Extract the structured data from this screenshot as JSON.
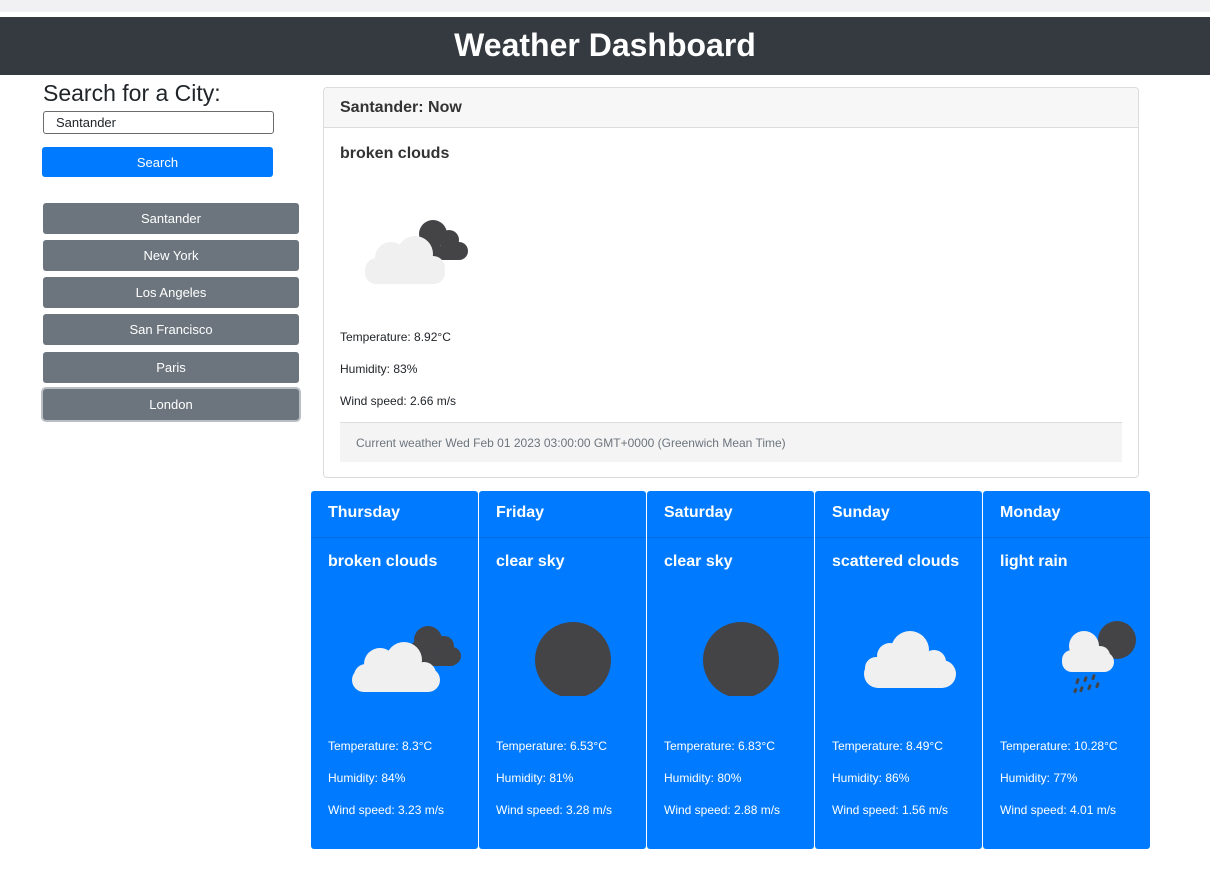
{
  "header": {
    "title": "Weather Dashboard"
  },
  "search": {
    "heading": "Search for a City:",
    "value": "Santander",
    "button_label": "Search"
  },
  "history": {
    "cities": [
      "Santander",
      "New York",
      "Los Angeles",
      "San Francisco",
      "Paris",
      "London"
    ]
  },
  "current": {
    "header": "Santander: Now",
    "description": "broken clouds",
    "icon": "broken-clouds-icon",
    "temperature": "Temperature: 8.92°C",
    "humidity": "Humidity: 83%",
    "wind": "Wind speed: 2.66 m/s",
    "footer": "Current weather Wed Feb 01 2023 03:00:00 GMT+0000 (Greenwich Mean Time)"
  },
  "forecast": [
    {
      "day": "Thursday",
      "description": "broken clouds",
      "icon": "broken-clouds-icon",
      "temperature": "Temperature: 8.3°C",
      "humidity": "Humidity: 84%",
      "wind": "Wind speed: 3.23 m/s"
    },
    {
      "day": "Friday",
      "description": "clear sky",
      "icon": "clear-sky-icon",
      "temperature": "Temperature: 6.53°C",
      "humidity": "Humidity: 81%",
      "wind": "Wind speed: 3.28 m/s"
    },
    {
      "day": "Saturday",
      "description": "clear sky",
      "icon": "clear-sky-icon",
      "temperature": "Temperature: 6.83°C",
      "humidity": "Humidity: 80%",
      "wind": "Wind speed: 2.88 m/s"
    },
    {
      "day": "Sunday",
      "description": "scattered clouds",
      "icon": "scattered-clouds-icon",
      "temperature": "Temperature: 8.49°C",
      "humidity": "Humidity: 86%",
      "wind": "Wind speed: 1.56 m/s"
    },
    {
      "day": "Monday",
      "description": "light rain",
      "icon": "light-rain-icon",
      "temperature": "Temperature: 10.28°C",
      "humidity": "Humidity: 77%",
      "wind": "Wind speed: 4.01 m/s"
    }
  ],
  "colors": {
    "header_bg": "#343a40",
    "primary": "#007bff",
    "secondary": "#6c757d",
    "icon_dark": "#444446",
    "icon_light": "#f0f0f0"
  }
}
